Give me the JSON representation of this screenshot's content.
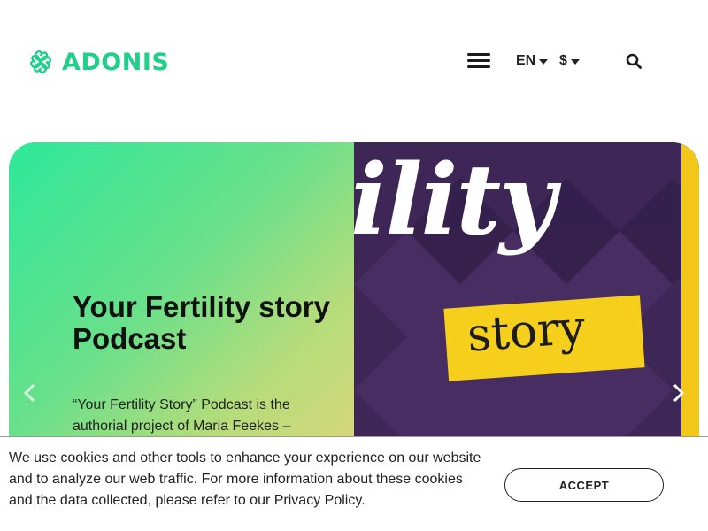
{
  "header": {
    "logo_text": "ADONIS",
    "language": "EN",
    "currency": "$"
  },
  "slide": {
    "title": "Your Fertility story Podcast",
    "description": "“Your Fertility Story” Podcast is the authorial project of Maria Feekes –",
    "image_text_top": "ility",
    "image_text_box": "story"
  },
  "cookie": {
    "message": "We use cookies and other tools to enhance your experience on our website and to analyze our web traffic. For more information about these cookies and the data collected, please refer to our Privacy Policy.",
    "accept_label": "ACCEPT"
  },
  "colors": {
    "brand": "#1fd08b",
    "slide_gradient_start": "#2ee89a",
    "slide_gradient_end": "#d8d67a",
    "podcast_bg": "#3b2552",
    "podcast_yellow": "#f6cf1d"
  },
  "icons": {
    "logo": "clover-logo-icon",
    "menu": "hamburger-menu-icon",
    "search": "search-icon",
    "prev": "chevron-left-icon",
    "next": "chevron-right-icon"
  }
}
